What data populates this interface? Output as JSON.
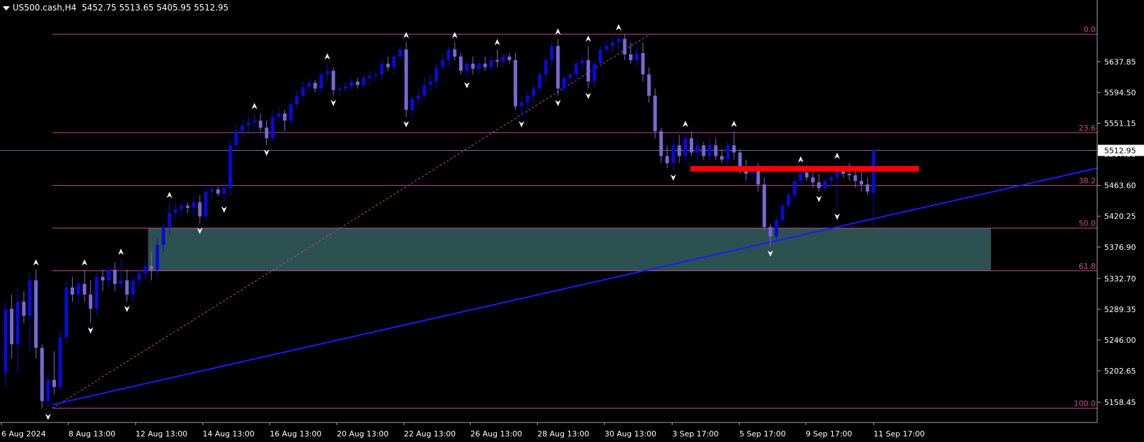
{
  "header": {
    "symbol": "US500.cash,H4",
    "open": "5452.75",
    "high": "5513.65",
    "low": "5405.95",
    "close": "5512.95"
  },
  "chart_data": {
    "type": "candlestick",
    "symbol": "US500.cash",
    "timeframe": "H4",
    "ylim": [
      5130,
      5705
    ],
    "y_ticks": [
      "5637.85",
      "5594.50",
      "5551.15",
      "5507.80",
      "5463.60",
      "5420.25",
      "5376.90",
      "5332.70",
      "5289.35",
      "5246.00",
      "5202.65",
      "5158.45"
    ],
    "x_ticks": [
      "6 Aug 2024",
      "8 Aug 13:00",
      "12 Aug 13:00",
      "14 Aug 13:00",
      "16 Aug 13:00",
      "20 Aug 13:00",
      "22 Aug 13:00",
      "26 Aug 13:00",
      "28 Aug 13:00",
      "30 Aug 13:00",
      "3 Sep 17:00",
      "5 Sep 17:00",
      "9 Sep 17:00",
      "11 Sep 17:00"
    ],
    "current_price": "5512.95",
    "fibonacci": {
      "levels": [
        {
          "label": "0.0",
          "price": 5676.5
        },
        {
          "label": "23.6",
          "price": 5538.0
        },
        {
          "label": "38.2",
          "price": 5463.6
        },
        {
          "label": "50.0",
          "price": 5403.5
        },
        {
          "label": "61.8",
          "price": 5343.5
        },
        {
          "label": "100.0",
          "price": 5150.0
        }
      ]
    },
    "zone": {
      "from": 5343.5,
      "to": 5403.5
    },
    "resistance": {
      "price": 5487.0
    },
    "trendline": {
      "from_price": 5155,
      "to_price": 5488
    },
    "candles": [
      [
        5200,
        5300,
        5180,
        5290
      ],
      [
        5290,
        5310,
        5220,
        5240
      ],
      [
        5240,
        5320,
        5200,
        5300
      ],
      [
        5300,
        5315,
        5270,
        5280
      ],
      [
        5280,
        5340,
        5230,
        5330
      ],
      [
        5330,
        5345,
        5220,
        5235
      ],
      [
        5235,
        5240,
        5150,
        5160
      ],
      [
        5160,
        5200,
        5148,
        5190
      ],
      [
        5190,
        5230,
        5170,
        5180
      ],
      [
        5180,
        5260,
        5175,
        5250
      ],
      [
        5250,
        5330,
        5240,
        5320
      ],
      [
        5320,
        5335,
        5300,
        5310
      ],
      [
        5310,
        5330,
        5295,
        5325
      ],
      [
        5325,
        5345,
        5300,
        5310
      ],
      [
        5310,
        5330,
        5270,
        5290
      ],
      [
        5290,
        5340,
        5280,
        5335
      ],
      [
        5335,
        5345,
        5315,
        5330
      ],
      [
        5330,
        5350,
        5320,
        5345
      ],
      [
        5345,
        5355,
        5315,
        5325
      ],
      [
        5325,
        5360,
        5320,
        5330
      ],
      [
        5330,
        5345,
        5300,
        5310
      ],
      [
        5310,
        5335,
        5300,
        5330
      ],
      [
        5330,
        5345,
        5320,
        5340
      ],
      [
        5340,
        5360,
        5330,
        5350
      ],
      [
        5350,
        5370,
        5330,
        5345
      ],
      [
        5345,
        5390,
        5335,
        5380
      ],
      [
        5380,
        5410,
        5370,
        5405
      ],
      [
        5405,
        5440,
        5395,
        5425
      ],
      [
        5425,
        5440,
        5415,
        5430
      ],
      [
        5430,
        5440,
        5420,
        5435
      ],
      [
        5435,
        5440,
        5425,
        5432
      ],
      [
        5432,
        5450,
        5420,
        5440
      ],
      [
        5440,
        5450,
        5410,
        5420
      ],
      [
        5420,
        5460,
        5415,
        5455
      ],
      [
        5455,
        5465,
        5445,
        5458
      ],
      [
        5458,
        5462,
        5448,
        5452
      ],
      [
        5452,
        5470,
        5440,
        5460
      ],
      [
        5460,
        5530,
        5450,
        5520
      ],
      [
        5520,
        5550,
        5510,
        5540
      ],
      [
        5540,
        5555,
        5530,
        5548
      ],
      [
        5548,
        5560,
        5538,
        5552
      ],
      [
        5552,
        5565,
        5540,
        5555
      ],
      [
        5555,
        5565,
        5540,
        5545
      ],
      [
        5545,
        5555,
        5520,
        5530
      ],
      [
        5530,
        5570,
        5525,
        5560
      ],
      [
        5560,
        5575,
        5550,
        5565
      ],
      [
        5565,
        5570,
        5540,
        5555
      ],
      [
        5555,
        5585,
        5550,
        5578
      ],
      [
        5578,
        5598,
        5570,
        5590
      ],
      [
        5590,
        5610,
        5585,
        5602
      ],
      [
        5602,
        5615,
        5595,
        5608
      ],
      [
        5608,
        5612,
        5595,
        5600
      ],
      [
        5600,
        5625,
        5595,
        5620
      ],
      [
        5620,
        5635,
        5610,
        5625
      ],
      [
        5625,
        5630,
        5590,
        5598
      ],
      [
        5598,
        5605,
        5590,
        5600
      ],
      [
        5600,
        5610,
        5595,
        5603
      ],
      [
        5603,
        5615,
        5598,
        5610
      ],
      [
        5610,
        5615,
        5600,
        5605
      ],
      [
        5605,
        5620,
        5600,
        5615
      ],
      [
        5615,
        5625,
        5605,
        5618
      ],
      [
        5618,
        5625,
        5610,
        5620
      ],
      [
        5620,
        5640,
        5612,
        5635
      ],
      [
        5635,
        5645,
        5625,
        5630
      ],
      [
        5630,
        5650,
        5620,
        5645
      ],
      [
        5645,
        5660,
        5640,
        5655
      ],
      [
        5655,
        5665,
        5560,
        5570
      ],
      [
        5570,
        5590,
        5560,
        5585
      ],
      [
        5585,
        5600,
        5575,
        5590
      ],
      [
        5590,
        5615,
        5585,
        5605
      ],
      [
        5605,
        5620,
        5595,
        5610
      ],
      [
        5610,
        5635,
        5600,
        5630
      ],
      [
        5630,
        5650,
        5625,
        5640
      ],
      [
        5640,
        5660,
        5630,
        5655
      ],
      [
        5655,
        5665,
        5640,
        5645
      ],
      [
        5645,
        5650,
        5620,
        5625
      ],
      [
        5625,
        5640,
        5615,
        5635
      ],
      [
        5635,
        5645,
        5620,
        5628
      ],
      [
        5628,
        5640,
        5620,
        5635
      ],
      [
        5635,
        5645,
        5625,
        5630
      ],
      [
        5630,
        5648,
        5625,
        5640
      ],
      [
        5640,
        5655,
        5630,
        5638
      ],
      [
        5638,
        5650,
        5630,
        5645
      ],
      [
        5645,
        5650,
        5635,
        5640
      ],
      [
        5640,
        5650,
        5570,
        5575
      ],
      [
        5575,
        5590,
        5560,
        5580
      ],
      [
        5580,
        5595,
        5565,
        5590
      ],
      [
        5590,
        5605,
        5580,
        5600
      ],
      [
        5600,
        5625,
        5595,
        5620
      ],
      [
        5620,
        5645,
        5610,
        5640
      ],
      [
        5640,
        5665,
        5630,
        5660
      ],
      [
        5660,
        5670,
        5590,
        5600
      ],
      [
        5600,
        5620,
        5595,
        5615
      ],
      [
        5615,
        5625,
        5605,
        5620
      ],
      [
        5620,
        5640,
        5610,
        5635
      ],
      [
        5635,
        5645,
        5625,
        5640
      ],
      [
        5640,
        5660,
        5600,
        5610
      ],
      [
        5610,
        5640,
        5600,
        5635
      ],
      [
        5635,
        5660,
        5630,
        5655
      ],
      [
        5655,
        5668,
        5650,
        5660
      ],
      [
        5660,
        5672,
        5650,
        5665
      ],
      [
        5665,
        5676,
        5655,
        5670
      ],
      [
        5670,
        5676,
        5640,
        5648
      ],
      [
        5648,
        5665,
        5635,
        5640
      ],
      [
        5640,
        5660,
        5630,
        5650
      ],
      [
        5650,
        5665,
        5610,
        5620
      ],
      [
        5620,
        5630,
        5580,
        5590
      ],
      [
        5590,
        5600,
        5530,
        5540
      ],
      [
        5540,
        5545,
        5495,
        5505
      ],
      [
        5505,
        5520,
        5488,
        5495
      ],
      [
        5495,
        5530,
        5485,
        5520
      ],
      [
        5520,
        5535,
        5495,
        5505
      ],
      [
        5505,
        5540,
        5495,
        5530
      ],
      [
        5530,
        5540,
        5505,
        5510
      ],
      [
        5510,
        5530,
        5495,
        5520
      ],
      [
        5520,
        5525,
        5500,
        5505
      ],
      [
        5505,
        5530,
        5495,
        5520
      ],
      [
        5520,
        5530,
        5500,
        5505
      ],
      [
        5505,
        5515,
        5495,
        5500
      ],
      [
        5500,
        5525,
        5490,
        5520
      ],
      [
        5520,
        5540,
        5500,
        5510
      ],
      [
        5510,
        5515,
        5480,
        5490
      ],
      [
        5490,
        5500,
        5470,
        5480
      ],
      [
        5480,
        5495,
        5470,
        5488
      ],
      [
        5488,
        5495,
        5455,
        5465
      ],
      [
        5465,
        5475,
        5400,
        5405
      ],
      [
        5405,
        5410,
        5378,
        5392
      ],
      [
        5392,
        5420,
        5388,
        5415
      ],
      [
        5415,
        5440,
        5410,
        5435
      ],
      [
        5435,
        5455,
        5430,
        5450
      ],
      [
        5450,
        5475,
        5445,
        5470
      ],
      [
        5470,
        5490,
        5465,
        5482
      ],
      [
        5482,
        5490,
        5470,
        5475
      ],
      [
        5475,
        5488,
        5460,
        5468
      ],
      [
        5468,
        5480,
        5455,
        5460
      ],
      [
        5460,
        5475,
        5455,
        5470
      ],
      [
        5470,
        5480,
        5460,
        5475
      ],
      [
        5475,
        5495,
        5430,
        5485
      ],
      [
        5485,
        5492,
        5475,
        5480
      ],
      [
        5480,
        5495,
        5470,
        5478
      ],
      [
        5478,
        5490,
        5460,
        5470
      ],
      [
        5470,
        5485,
        5455,
        5465
      ],
      [
        5465,
        5475,
        5450,
        5455
      ],
      [
        5452.75,
        5513.65,
        5405.95,
        5512.95
      ]
    ]
  },
  "colors": {
    "bull": "#0a0ad6",
    "bear": "#7b68d6",
    "fib": "#c04a9a",
    "fib_label": "#c85090",
    "zone": "#2f5555",
    "resistance": "#ff0000",
    "trendline": "#1a1aff",
    "price_line": "#5f7f93",
    "axis_text": "#ffffff"
  }
}
